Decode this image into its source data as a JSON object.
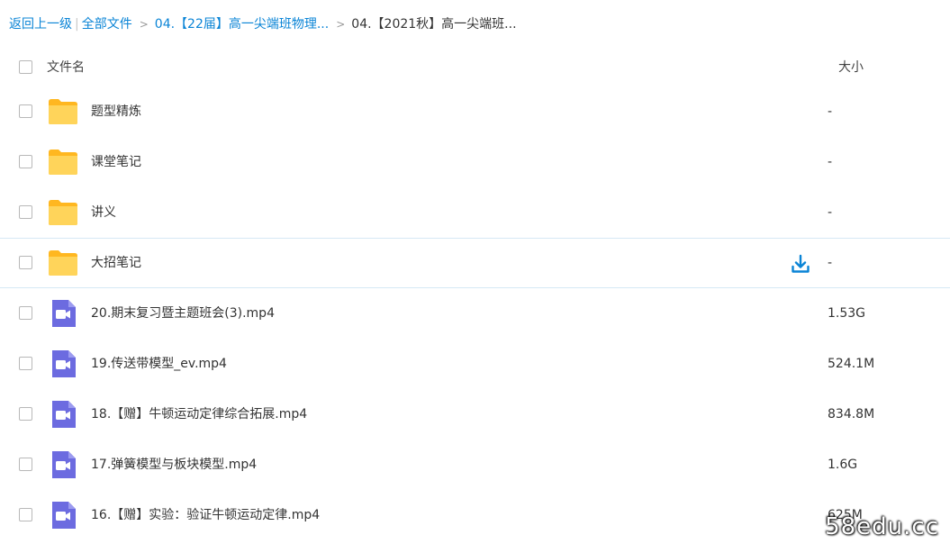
{
  "breadcrumb": {
    "back": "返回上一级",
    "all_files": "全部文件",
    "sep": ">",
    "crumb1": "04.【22届】高一尖端班物理...",
    "current": "04.【2021秋】高一尖端班..."
  },
  "header": {
    "name_col": "文件名",
    "size_col": "大小"
  },
  "rows": [
    {
      "name": "题型精炼",
      "size": "-",
      "type": "folder-icon"
    },
    {
      "name": "课堂笔记",
      "size": "-",
      "type": "folder-icon"
    },
    {
      "name": "讲义",
      "size": "-",
      "type": "folder-icon"
    },
    {
      "name": "大招笔记",
      "size": "-",
      "type": "folder-icon"
    },
    {
      "name": "20.期末复习暨主题班会(3).mp4",
      "size": "1.53G",
      "type": "video-file-icon"
    },
    {
      "name": "19.传送带模型_ev.mp4",
      "size": "524.1M",
      "type": "video-file-icon"
    },
    {
      "name": "18.【赠】牛顿运动定律综合拓展.mp4",
      "size": "834.8M",
      "type": "video-file-icon"
    },
    {
      "name": "17.弹簧模型与板块模型.mp4",
      "size": "1.6G",
      "type": "video-file-icon"
    },
    {
      "name": "16.【赠】实验：验证牛顿运动定律.mp4",
      "size": "625M",
      "type": "video-file-icon"
    }
  ],
  "download_icon": "download-icon",
  "colors": {
    "link": "#0a84d6",
    "folder": "#ffc93d",
    "video": "#6c6be0",
    "download": "#0a84d6"
  },
  "watermark": "58edu.cc"
}
